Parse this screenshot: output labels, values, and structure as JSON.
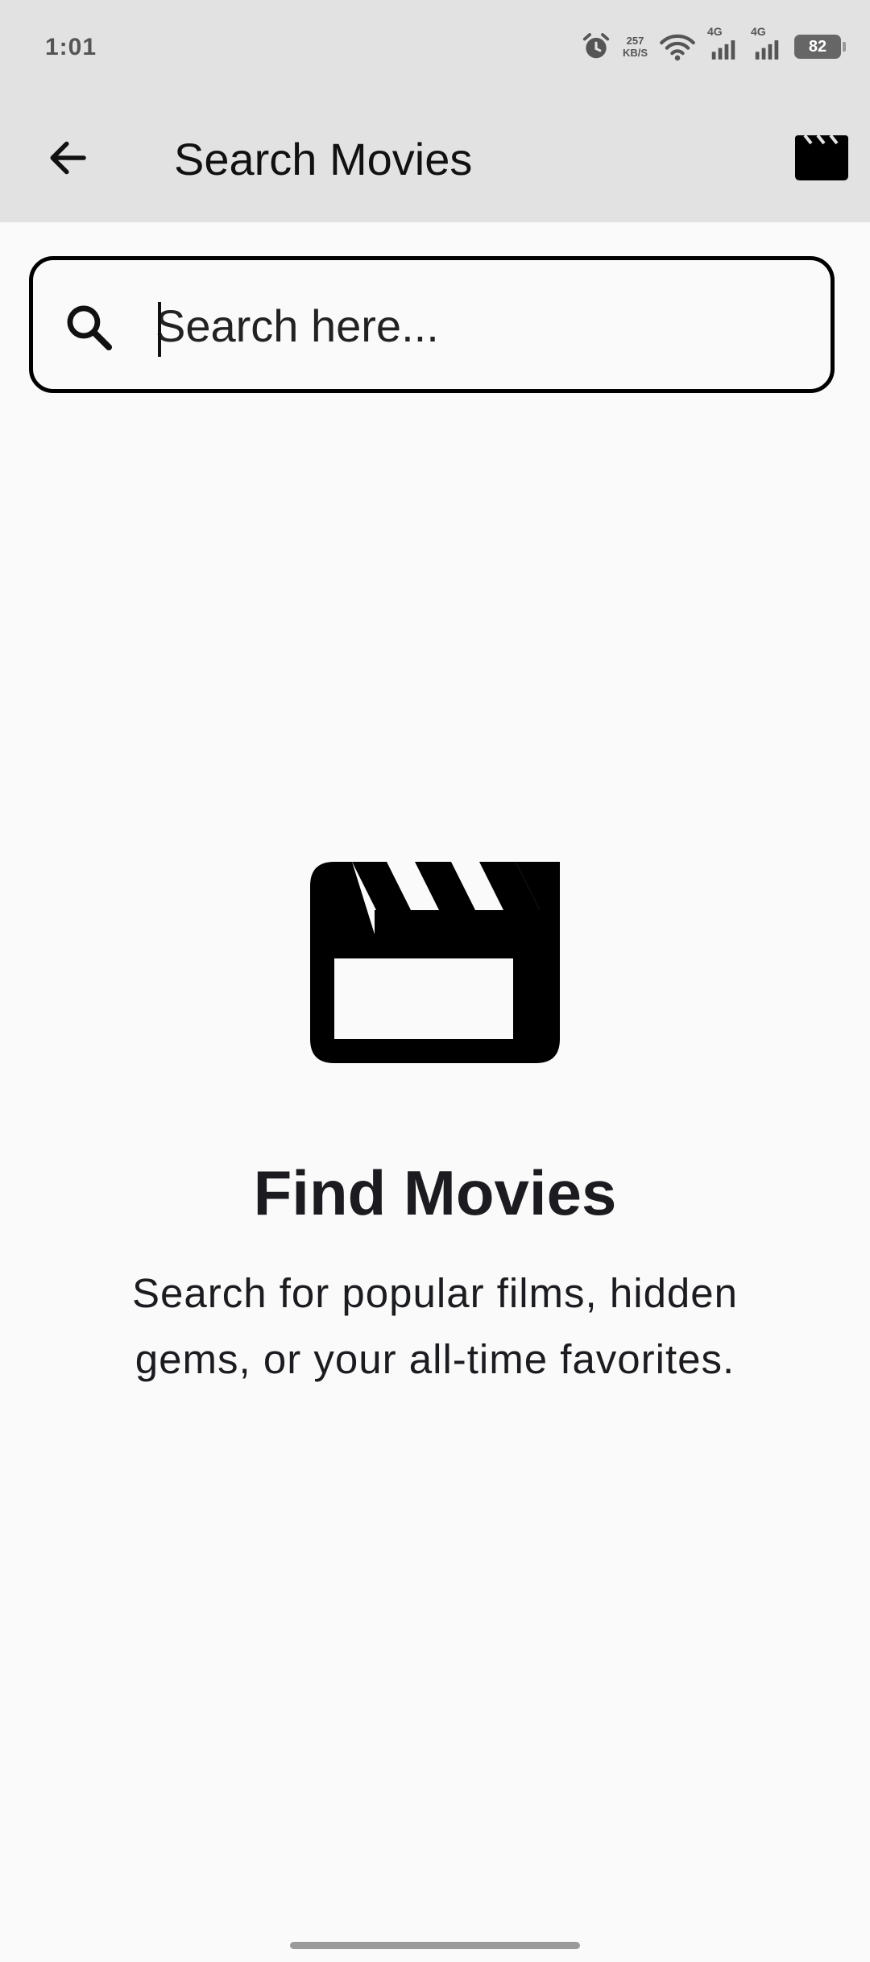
{
  "status_bar": {
    "time": "1:01",
    "net_speed_value": "257",
    "net_speed_unit": "KB/S",
    "signal_1_label": "4G",
    "signal_2_label": "4G",
    "battery_level": "82",
    "icons": [
      "alarm-icon",
      "wifi-icon",
      "signal-icon",
      "signal-icon",
      "battery-icon"
    ]
  },
  "app_bar": {
    "title": "Search Movies",
    "back_icon": "arrow-back-icon",
    "action_icon": "clapperboard-icon"
  },
  "search": {
    "placeholder": "Search here...",
    "value": "",
    "icon": "search-icon"
  },
  "empty_state": {
    "icon": "clapperboard-icon",
    "title": "Find Movies",
    "subtitle": "Search for popular films, hidden gems, or your all-time favorites."
  },
  "colors": {
    "app_bar_background": "#e2e2e2",
    "page_background": "#fafafa",
    "text_primary": "#1c1b1f"
  }
}
